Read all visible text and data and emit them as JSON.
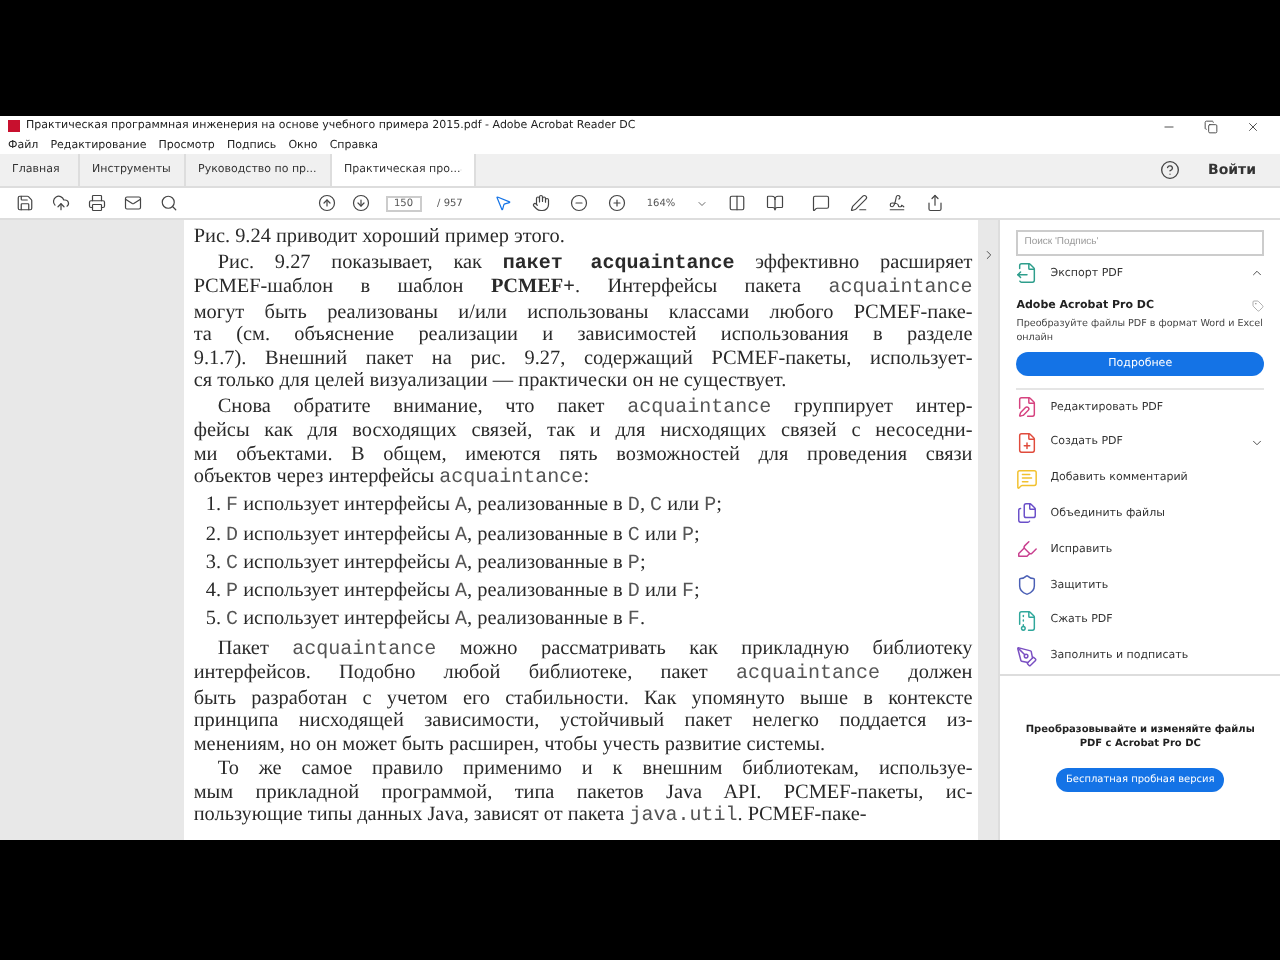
{
  "window": {
    "title": "Практическая программная инженерия на основе учебного примера 2015.pdf - Adobe Acrobat Reader DC"
  },
  "menu": [
    "Файл",
    "Редактирование",
    "Просмотр",
    "Подпись",
    "Окно",
    "Справка"
  ],
  "tabs": [
    {
      "label": "Главная",
      "selected": false
    },
    {
      "label": "Инструменты",
      "selected": false
    },
    {
      "label": "Руководство по пр...",
      "selected": false
    },
    {
      "label": "Практическая про...",
      "selected": true
    }
  ],
  "sign_in": "Войти",
  "toolbar": {
    "page": "150",
    "page_count": "/ 957",
    "zoom": "164%"
  },
  "document": {
    "paragraphs": [
      {
        "kind": "para",
        "indent": false,
        "lines": [
          [
            {
              "kind": "plain",
              "text": "Рис. 9.24 приводит хороший пример этого."
            }
          ]
        ]
      },
      {
        "kind": "para",
        "indent": true,
        "lines": [
          [
            {
              "kind": "plain",
              "text": "Рис. 9.27 показывает, как "
            },
            {
              "kind": "bold-mono",
              "text": "пакет acquaintance"
            },
            {
              "kind": "plain",
              "text": " эффективно расширяет"
            }
          ],
          [
            {
              "kind": "plain",
              "text": "PCMEF-шаблон в шаблон "
            },
            {
              "kind": "bold",
              "text": "PCMEF+"
            },
            {
              "kind": "plain",
              "text": ". Интерфейсы пакета "
            },
            {
              "kind": "mono",
              "text": "acquaintance"
            }
          ],
          [
            {
              "kind": "plain",
              "text": "могут быть реализованы и/или использованы классами любого PCMEF-паке-"
            }
          ],
          [
            {
              "kind": "plain",
              "text": "та (см. объяснение реализации и зависимостей использования в разделе"
            }
          ],
          [
            {
              "kind": "plain",
              "text": "9.1.7). Внешний пакет на рис. 9.27, содержащий PCMEF-пакеты, использует-"
            }
          ],
          [
            {
              "kind": "plain",
              "text": "ся только для целей визуализации — практически он не существует."
            }
          ]
        ]
      },
      {
        "kind": "para",
        "indent": true,
        "lines": [
          [
            {
              "kind": "plain",
              "text": "Снова обратите внимание, что пакет "
            },
            {
              "kind": "mono",
              "text": "acquaintance"
            },
            {
              "kind": "plain",
              "text": " группирует интер-"
            }
          ],
          [
            {
              "kind": "plain",
              "text": "фейсы как для восходящих связей, так и для нисходящих связей с несоседни-"
            }
          ],
          [
            {
              "kind": "plain",
              "text": "ми объектами. В общем, имеются пять возможностей для проведения связи"
            }
          ],
          [
            {
              "kind": "plain",
              "text": "объектов через интерфейсы "
            },
            {
              "kind": "mono",
              "text": "acquaintance"
            },
            {
              "kind": "plain",
              "text": ":"
            }
          ]
        ]
      },
      {
        "kind": "item",
        "lines": [
          [
            {
              "kind": "plain",
              "text": "1. "
            },
            {
              "kind": "mono",
              "text": "F"
            },
            {
              "kind": "plain",
              "text": " использует интерфейсы "
            },
            {
              "kind": "mono",
              "text": "A"
            },
            {
              "kind": "plain",
              "text": ", реализованные в "
            },
            {
              "kind": "mono",
              "text": "D"
            },
            {
              "kind": "plain",
              "text": ", "
            },
            {
              "kind": "mono",
              "text": "C"
            },
            {
              "kind": "plain",
              "text": " или "
            },
            {
              "kind": "mono",
              "text": "P"
            },
            {
              "kind": "plain",
              "text": ";"
            }
          ]
        ]
      },
      {
        "kind": "item",
        "lines": [
          [
            {
              "kind": "plain",
              "text": "2. "
            },
            {
              "kind": "mono",
              "text": "D"
            },
            {
              "kind": "plain",
              "text": " использует интерфейсы "
            },
            {
              "kind": "mono",
              "text": "A"
            },
            {
              "kind": "plain",
              "text": ", реализованные в "
            },
            {
              "kind": "mono",
              "text": "C"
            },
            {
              "kind": "plain",
              "text": " или "
            },
            {
              "kind": "mono",
              "text": "P"
            },
            {
              "kind": "plain",
              "text": ";"
            }
          ]
        ]
      },
      {
        "kind": "item",
        "lines": [
          [
            {
              "kind": "plain",
              "text": "3. "
            },
            {
              "kind": "mono",
              "text": "C"
            },
            {
              "kind": "plain",
              "text": " использует интерфейсы "
            },
            {
              "kind": "mono",
              "text": "A"
            },
            {
              "kind": "plain",
              "text": ", реализованные в "
            },
            {
              "kind": "mono",
              "text": "P"
            },
            {
              "kind": "plain",
              "text": ";"
            }
          ]
        ]
      },
      {
        "kind": "item",
        "lines": [
          [
            {
              "kind": "plain",
              "text": "4. "
            },
            {
              "kind": "mono",
              "text": "P"
            },
            {
              "kind": "plain",
              "text": " использует интерфейсы "
            },
            {
              "kind": "mono",
              "text": "A"
            },
            {
              "kind": "plain",
              "text": ", реализованные в "
            },
            {
              "kind": "mono",
              "text": "D"
            },
            {
              "kind": "plain",
              "text": " или "
            },
            {
              "kind": "mono",
              "text": "F"
            },
            {
              "kind": "plain",
              "text": ";"
            }
          ]
        ]
      },
      {
        "kind": "item",
        "lines": [
          [
            {
              "kind": "plain",
              "text": "5. "
            },
            {
              "kind": "mono",
              "text": "C"
            },
            {
              "kind": "plain",
              "text": " использует интерфейсы "
            },
            {
              "kind": "mono",
              "text": "A"
            },
            {
              "kind": "plain",
              "text": ", реализованные в "
            },
            {
              "kind": "mono",
              "text": "F"
            },
            {
              "kind": "plain",
              "text": "."
            }
          ]
        ]
      },
      {
        "kind": "para",
        "indent": true,
        "lines": [
          [
            {
              "kind": "plain",
              "text": "Пакет "
            },
            {
              "kind": "mono",
              "text": "acquaintance"
            },
            {
              "kind": "plain",
              "text": " можно рассматривать как прикладную библиотеку"
            }
          ],
          [
            {
              "kind": "plain",
              "text": "интерфейсов. Подобно любой библиотеке, пакет "
            },
            {
              "kind": "mono",
              "text": "acquaintance"
            },
            {
              "kind": "plain",
              "text": " должен"
            }
          ],
          [
            {
              "kind": "plain",
              "text": "быть разработан с учетом его стабильности. Как упомянуто выше в контексте"
            }
          ],
          [
            {
              "kind": "plain",
              "text": "принципа нисходящей зависимости, устойчивый пакет нелегко поддается из-"
            }
          ],
          [
            {
              "kind": "plain",
              "text": "менениям, но он может быть расширен, чтобы учесть развитие системы."
            }
          ]
        ]
      },
      {
        "kind": "para",
        "indent": true,
        "lines": [
          [
            {
              "kind": "plain",
              "text": "То же самое правило применимо и к внешним библиотекам, используе-"
            }
          ],
          [
            {
              "kind": "plain",
              "text": "мым прикладной программой, типа пакетов Java API. PCMEF-пакеты, ис-"
            }
          ],
          [
            {
              "kind": "plain",
              "text": "пользующие типы данных Java, зависят от пакета "
            },
            {
              "kind": "mono",
              "text": "java.util"
            },
            {
              "kind": "plain",
              "text": ". PCMEF-паке-"
            }
          ]
        ]
      }
    ]
  },
  "side_panel": {
    "search": {
      "placeholder": "Поиск 'Подпись'"
    },
    "export": {
      "label": "Экспорт PDF",
      "expanded": true,
      "color": "#2e9e8c",
      "product": "Adobe Acrobat Pro DC",
      "description": "Преобразуйте файлы PDF в формат Word и Excel онлайн",
      "button": "Подробнее"
    },
    "tools": [
      {
        "label": "Редактировать PDF",
        "color": "#d6427f"
      },
      {
        "label": "Создать PDF",
        "color": "#e04b3c",
        "expanded": false
      },
      {
        "label": "Добавить комментарий",
        "color": "#f2c12e"
      },
      {
        "label": "Объединить файлы",
        "color": "#6a4fc9"
      },
      {
        "label": "Исправить",
        "color": "#c9408f"
      },
      {
        "label": "Защитить",
        "color": "#4a5fb5"
      },
      {
        "label": "Сжать PDF",
        "color": "#2fa79b"
      },
      {
        "label": "Заполнить и подписать",
        "color": "#7a4fc2"
      }
    ],
    "promo": {
      "text": "Преобразовывайте и изменяйте файлы PDF с Acrobat Pro DC",
      "button": "Бесплатная пробная версия"
    }
  }
}
